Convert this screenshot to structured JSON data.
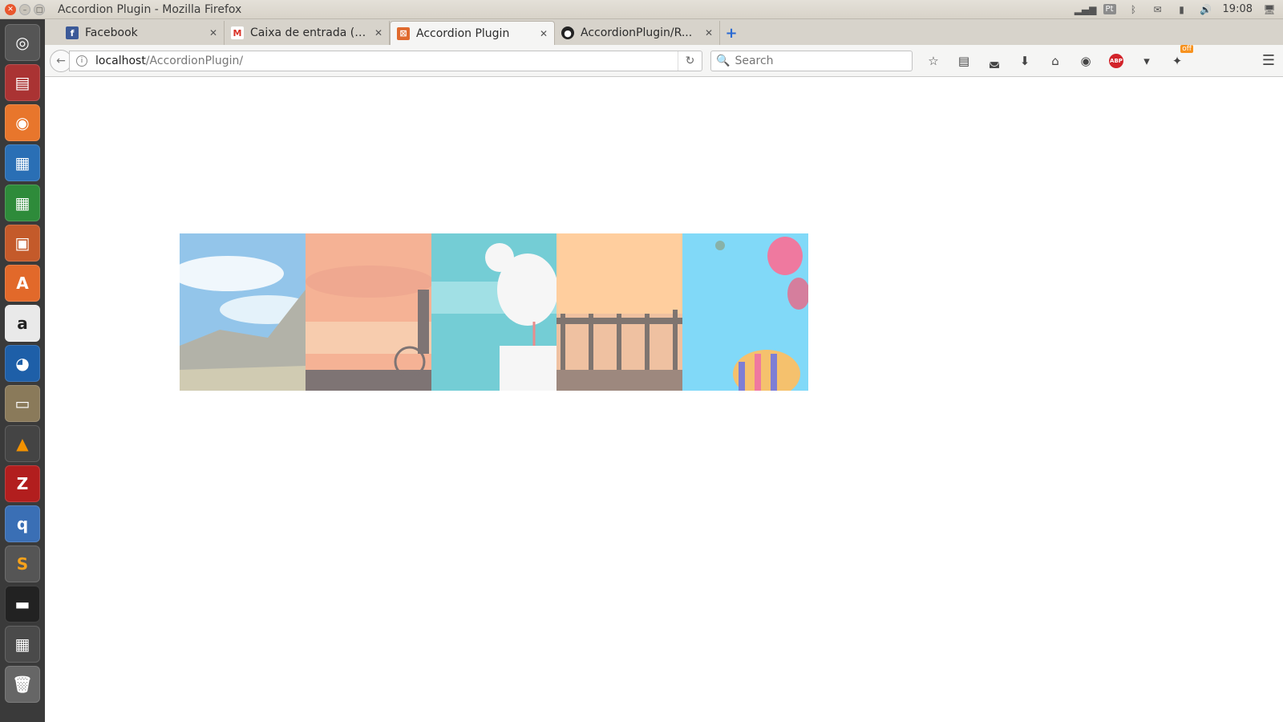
{
  "window": {
    "title": "Accordion Plugin - Mozilla Firefox"
  },
  "system_tray": {
    "keyboard_layout": "Pt",
    "clock": "19:08"
  },
  "tabs": [
    {
      "title": "Facebook",
      "icon": "facebook-icon",
      "active": false
    },
    {
      "title": "Caixa de entrada (1...",
      "icon": "gmail-icon",
      "active": false
    },
    {
      "title": "Accordion Plugin",
      "icon": "page-icon",
      "active": true
    },
    {
      "title": "AccordionPlugin/R...",
      "icon": "github-icon",
      "active": false
    }
  ],
  "navbar": {
    "url_host": "localhost",
    "url_path": "/AccordionPlugin/",
    "search_placeholder": "Search",
    "extension_badge": "off"
  },
  "accordion": {
    "panels": [
      {
        "name": "mountain-sky",
        "colors": [
          "#5aa7e0",
          "#9ad0f0",
          "#8a8a7a"
        ]
      },
      {
        "name": "sunset-cyclist",
        "colors": [
          "#f08a5d",
          "#f4b183",
          "#3a2a2a"
        ]
      },
      {
        "name": "seagull-sea",
        "colors": [
          "#2bb3c0",
          "#6fd0d8",
          "#f2f2f2"
        ]
      },
      {
        "name": "pier-sunset",
        "colors": [
          "#ffb56b",
          "#e8a070",
          "#3c2c24"
        ]
      },
      {
        "name": "hot-air-balloons",
        "colors": [
          "#3ec6f5",
          "#7fd9fb",
          "#e8336c"
        ]
      }
    ]
  }
}
